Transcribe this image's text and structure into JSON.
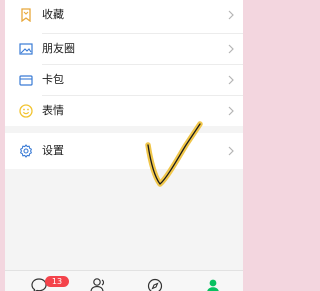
{
  "menu": {
    "items": [
      {
        "id": "favorites",
        "label": "收藏",
        "icon": "favorites-icon"
      },
      {
        "id": "moments",
        "label": "朋友圈",
        "icon": "moments-photo-icon"
      },
      {
        "id": "wallet",
        "label": "卡包",
        "icon": "card-wallet-icon"
      },
      {
        "id": "emoji",
        "label": "表情",
        "icon": "smiley-icon"
      }
    ],
    "settings": {
      "label": "设置",
      "icon": "gear-icon"
    }
  },
  "tabbar": {
    "chats_badge": "13",
    "tabs": [
      "chat-bubble-icon",
      "contacts-icon",
      "discover-compass-icon",
      "me-person-icon"
    ]
  },
  "colors": {
    "accent_blue": "#3a7bd5",
    "emoji_yellow": "#f2c431",
    "badge_red": "#f4434b",
    "me_green": "#07c160",
    "annotation_yellow": "#f0c64a"
  }
}
